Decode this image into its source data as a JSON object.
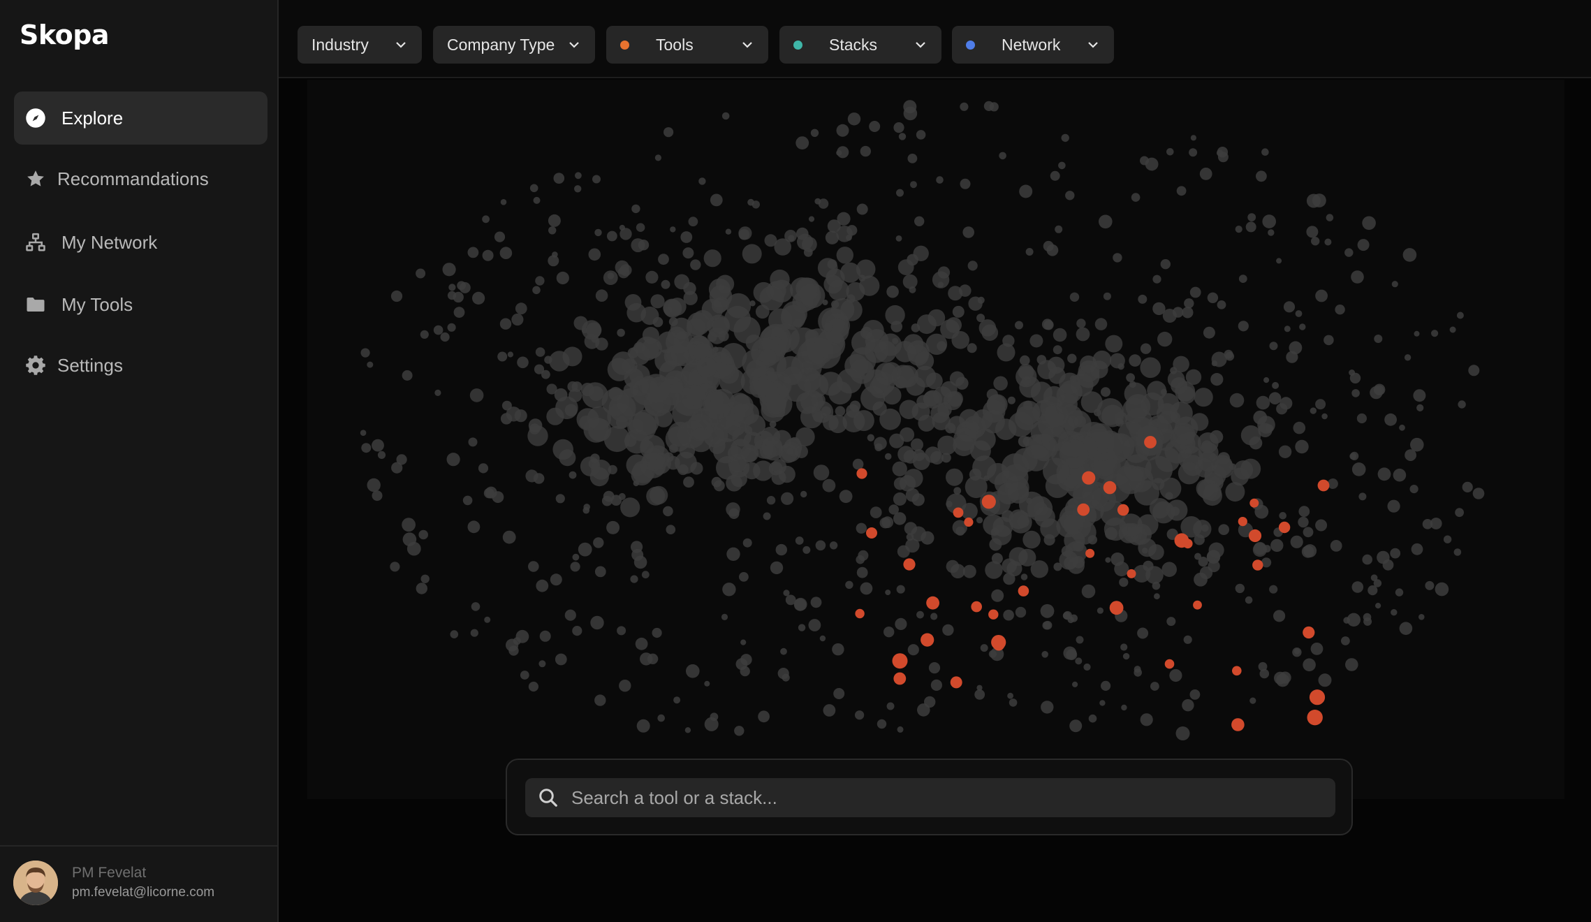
{
  "app": {
    "name": "Skopa"
  },
  "sidebar": {
    "items": [
      {
        "label": "Explore",
        "icon": "compass-icon",
        "active": true
      },
      {
        "label": "Recommandations",
        "icon": "star-icon",
        "active": false
      },
      {
        "label": "My Network",
        "icon": "network-icon",
        "active": false
      },
      {
        "label": "My Tools",
        "icon": "folder-icon",
        "active": false
      },
      {
        "label": "Settings",
        "icon": "gear-icon",
        "active": false
      }
    ]
  },
  "user": {
    "name": "PM Fevelat",
    "email": "pm.fevelat@licorne.com"
  },
  "filters": [
    {
      "label": "Industry",
      "dot": null
    },
    {
      "label": "Company Type",
      "dot": null
    },
    {
      "label": "Tools",
      "dot": "#e8732f"
    },
    {
      "label": "Stacks",
      "dot": "#3fb6a8"
    },
    {
      "label": "Network",
      "dot": "#4f7de8"
    }
  ],
  "search": {
    "placeholder": "Search a tool or a stack..."
  },
  "colors": {
    "node": "#3d3d3d",
    "highlight": "#d24a2c",
    "background": "#050505"
  }
}
